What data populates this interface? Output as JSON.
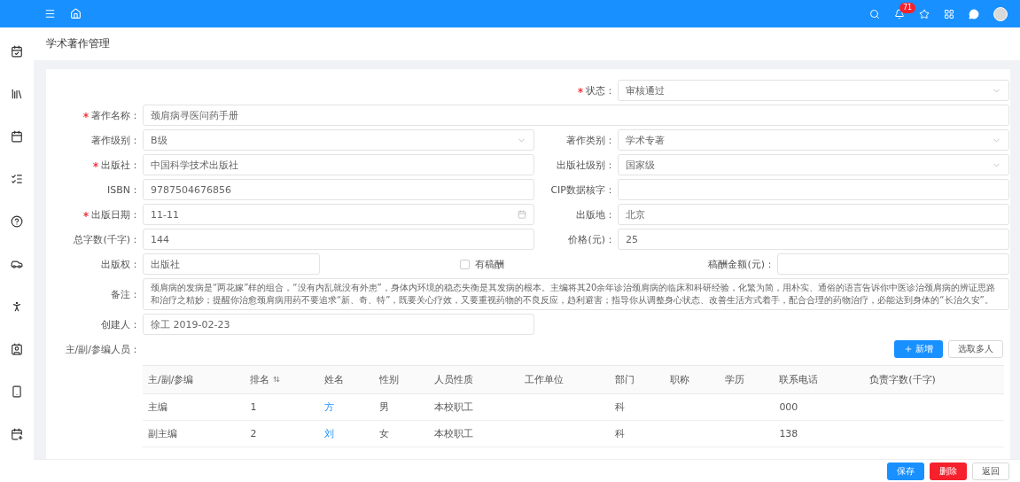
{
  "topbar": {
    "notification_count": "71"
  },
  "page_title": "学术著作管理",
  "form": {
    "rows": [
      {
        "right": {
          "label": "状态：",
          "required": true,
          "kind": "select",
          "value": "审核通过"
        }
      },
      {
        "full": {
          "label": "著作名称：",
          "required": true,
          "kind": "text",
          "value": "颈肩病寻医问药手册"
        }
      },
      {
        "left": {
          "label": "著作级别：",
          "required": false,
          "kind": "select",
          "value": "B级"
        },
        "right": {
          "label": "著作类别：",
          "required": false,
          "kind": "select",
          "value": "学术专著"
        }
      },
      {
        "left": {
          "label": "出版社：",
          "required": true,
          "kind": "text",
          "value": "中国科学技术出版社"
        },
        "right": {
          "label": "出版社级别：",
          "required": false,
          "kind": "select",
          "value": "国家级"
        }
      },
      {
        "left": {
          "label": "ISBN：",
          "required": false,
          "kind": "text",
          "value": "9787504676856"
        },
        "right": {
          "label": "CIP数据核字：",
          "required": false,
          "kind": "text"
        }
      },
      {
        "left": {
          "label": "出版日期：",
          "required": true,
          "kind": "date",
          "value": "11-11"
        },
        "right": {
          "label": "出版地：",
          "required": false,
          "kind": "text",
          "value": "北京"
        }
      },
      {
        "left": {
          "label": "总字数(千字)：",
          "required": false,
          "kind": "text",
          "value": "144"
        },
        "right": {
          "label": "价格(元)：",
          "required": false,
          "kind": "text",
          "value": "25"
        }
      },
      {
        "left": {
          "label": "出版权：",
          "required": false,
          "kind": "text",
          "value": "出版社"
        },
        "middle": {
          "label": "有稿酬",
          "kind": "checkbox",
          "checked": false
        },
        "right": {
          "label": "稿酬金额(元)：",
          "required": false,
          "kind": "text"
        }
      },
      {
        "full": {
          "label": "备注：",
          "required": false,
          "kind": "textarea",
          "value": "颈肩病的发病是“两花嫁”样的组合，“没有内乱就没有外患”，身体内环境的稳态失衡是其发病的根本。主编将其20余年诊治颈肩病的临床和科研经验，化繁为简，用朴实、通俗的语言告诉你中医诊治颈肩病的辨证思路和治疗之精妙；提醒你治愈颈肩病用药不要追求“新、奇、特”，既要关心疗效，又要重视药物的不良反应，趋利避害；指导你从调整身心状态、改善生活方式着手，配合合理的药物治疗，必能达到身体的“长治久安”。"
        }
      },
      {
        "left": {
          "label": "创建人：",
          "required": false,
          "kind": "text",
          "value": "徐工 2019-02-23"
        }
      }
    ]
  },
  "members": {
    "label": "主/副/参编人员：",
    "buttons": [
      {
        "label": "新增",
        "kind": "primary"
      },
      {
        "label": "选取多人",
        "kind": "default"
      }
    ],
    "columns": [
      {
        "label": "主/副/参编",
        "sortable": false
      },
      {
        "label": "排名",
        "sortable": true
      },
      {
        "label": "姓名",
        "sortable": false
      },
      {
        "label": "性别",
        "sortable": false
      },
      {
        "label": "人员性质",
        "sortable": false
      },
      {
        "label": "工作单位",
        "sortable": false
      },
      {
        "label": "部门",
        "sortable": false
      },
      {
        "label": "职称",
        "sortable": false
      },
      {
        "label": "学历",
        "sortable": false
      },
      {
        "label": "联系电话",
        "sortable": false
      },
      {
        "label": "负责字数(千字)",
        "sortable": false
      }
    ],
    "rows": [
      [
        "主编",
        "1",
        "方",
        "男",
        "本校职工",
        "",
        "科",
        "",
        "",
        "000",
        ""
      ],
      [
        "副主编",
        "2",
        "刘",
        "女",
        "本校职工",
        "",
        "科",
        "",
        "",
        "138",
        ""
      ]
    ]
  },
  "footer_buttons": [
    {
      "label": "保存",
      "kind": "primary"
    },
    {
      "label": "删除",
      "kind": "danger"
    },
    {
      "label": "返回",
      "kind": "default"
    }
  ]
}
